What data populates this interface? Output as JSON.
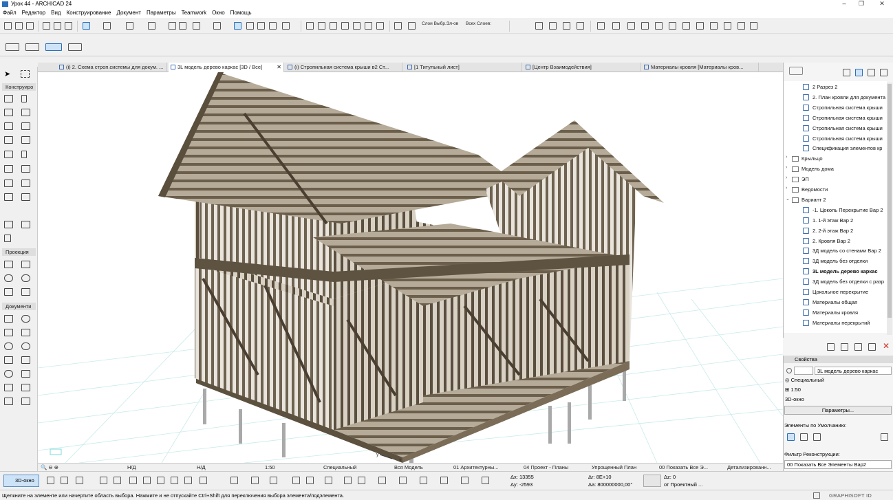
{
  "window": {
    "title": "Урок 44 - ARCHICAD 24"
  },
  "menu": [
    "Файл",
    "Редактор",
    "Вид",
    "Конструирование",
    "Документ",
    "Параметры",
    "Teamwork",
    "Окно",
    "Помощь"
  ],
  "toolbar": {
    "layers_label": "Слои Выбр.Эл-ов",
    "all_layers_label": "Всех Слоев:"
  },
  "tabs": [
    {
      "label": "(i) 2. Схема строп.системы для докум. ...",
      "active": false
    },
    {
      "label": "3L модель дерево каркас [3D / Все]",
      "active": true
    },
    {
      "label": "(i) Стропильная система крыши в2 Ст...",
      "active": false
    },
    {
      "label": "[1 Титульный лист]",
      "active": false
    },
    {
      "label": "[Центр Взаимодействия]",
      "active": false
    },
    {
      "label": "Материалы кровля [Материалы кров...",
      "active": false
    }
  ],
  "toolbox": {
    "sections": [
      "Конструиро",
      "Проекция",
      "Документи"
    ]
  },
  "navigator": {
    "items": [
      {
        "label": "2 Разрез 2",
        "type": "view",
        "indent": 2
      },
      {
        "label": "2. План кровли для документа",
        "type": "view",
        "indent": 2
      },
      {
        "label": "Стропильная система крыши",
        "type": "view",
        "indent": 2
      },
      {
        "label": "Стропильная система крыши",
        "type": "view",
        "indent": 2
      },
      {
        "label": "Стропильная система крыши",
        "type": "view",
        "indent": 2
      },
      {
        "label": "Стропильная система крыши",
        "type": "view",
        "indent": 2
      },
      {
        "label": "Спецификация элементов кр",
        "type": "view",
        "indent": 2
      },
      {
        "label": "Крыльцо",
        "type": "folder",
        "indent": 1
      },
      {
        "label": "Модель дома",
        "type": "folder",
        "indent": 1
      },
      {
        "label": "ЭП",
        "type": "folder",
        "indent": 1
      },
      {
        "label": "Ведомости",
        "type": "folder",
        "indent": 1
      },
      {
        "label": "Вариант 2",
        "type": "folder-open",
        "indent": 1
      },
      {
        "label": "-1. Цоколь Перекрытие Вар 2",
        "type": "view",
        "indent": 2
      },
      {
        "label": "1. 1-й этаж Вар 2",
        "type": "view",
        "indent": 2
      },
      {
        "label": "2. 2-й этаж Вар 2",
        "type": "view",
        "indent": 2
      },
      {
        "label": "2. Кровля Вар 2",
        "type": "view",
        "indent": 2
      },
      {
        "label": "3Д модель со стенами Вар 2",
        "type": "view",
        "indent": 2
      },
      {
        "label": "3Д модель без отделки",
        "type": "view",
        "indent": 2
      },
      {
        "label": "3L модель дерево каркас",
        "type": "view",
        "indent": 2,
        "bold": true
      },
      {
        "label": "3Д модель без отделки с разр",
        "type": "view",
        "indent": 2
      },
      {
        "label": "Цокольное перекрытие",
        "type": "view",
        "indent": 2
      },
      {
        "label": "Материалы общая",
        "type": "view",
        "indent": 2
      },
      {
        "label": "Материалы кровля",
        "type": "view",
        "indent": 2
      },
      {
        "label": "Материалы перекрытий",
        "type": "view",
        "indent": 2
      }
    ]
  },
  "properties": {
    "title": "Свойства",
    "name_value": "3L модель дерево каркас",
    "type": "Специальный",
    "scale": "1:50",
    "window": "3D-окно",
    "params_button": "Параметры...",
    "defaults_label": "Элементы по Умолчанию:",
    "filter_label": "Фильтр Реконструкции:",
    "filter_value": "00 Показать Все Элементы Вар2"
  },
  "quick_options": {
    "nd1": "Н/Д",
    "nd2": "Н/Д",
    "scale": "1:50",
    "structure": "Специальный",
    "model": "Вся Модель",
    "layers": "01 Архитектурны...",
    "pen": "04 Проект - Планы",
    "plan": "Упрощенный План",
    "renovation": "00 Показать Все Э...",
    "detail": "Детализированн..."
  },
  "bottom": {
    "view_3d": "3D-окно",
    "dx_label": "Δx:",
    "dx": "13355",
    "dy_label": "Δy:",
    "dy": "-2593",
    "dr_label": "Δr:",
    "dr": "8E+10",
    "da_label": "Δa:",
    "da": "800000000,00°",
    "dz_label": "Δz:",
    "dz": "0",
    "ref": "от Проектный ..."
  },
  "status": {
    "hint": "Щелкните на элементе или начертите область выбора. Нажмите и не отпускайте Ctrl+Shift для переключения выбора элемента/подэлемента.",
    "brand": "GRAPHISOFT ID"
  }
}
